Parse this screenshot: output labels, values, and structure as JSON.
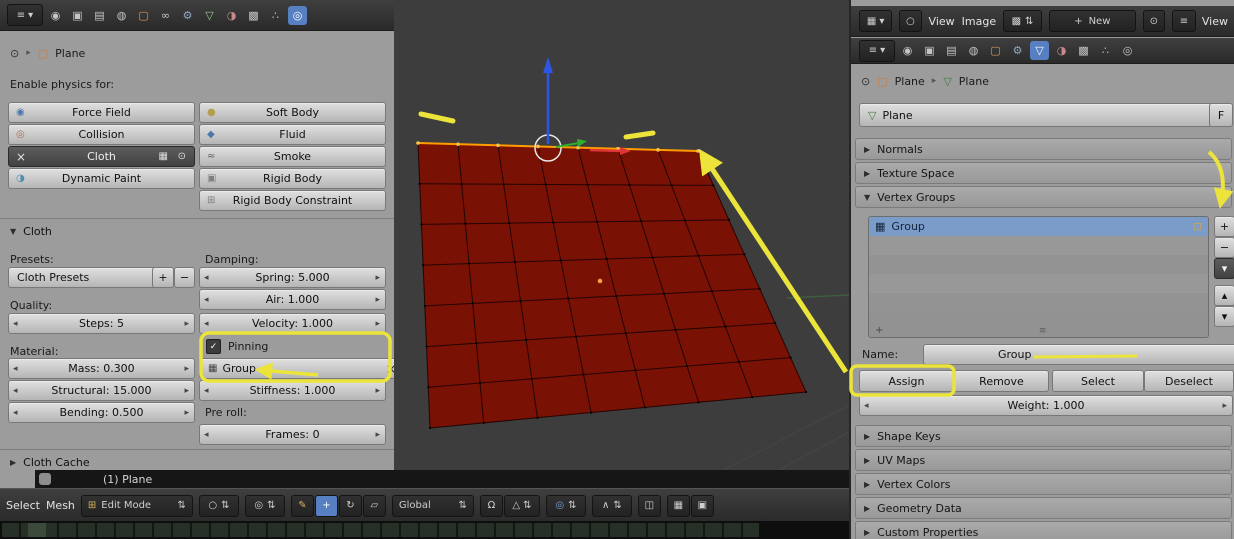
{
  "colors": {
    "accent_blue": "#5680c2",
    "annotation_yellow": "#ece43a",
    "cloth_red": "#7a1105",
    "cloth_wire": "#240402",
    "selected_edge_orange": "#ff9d00",
    "list_selection_blue": "#7b9cc9"
  },
  "icons": {
    "editor_type": "≡",
    "dropdown": "▾",
    "updown": "⇅",
    "pin": "⊙",
    "chevron_right": "▸",
    "cube": "▢",
    "mesh_data": "▽",
    "render_tab": "◉",
    "layers_tab": "▣",
    "scene_tab": "▤",
    "world_tab": "◍",
    "object_tab": "▢",
    "constraints_tab": "∞",
    "modifiers_tab": "⚙",
    "data_tab": "▽",
    "material_tab": "◑",
    "texture_tab": "▩",
    "particles_tab": "∴",
    "physics_tab": "◎",
    "force_field": "◉",
    "collision": "◎",
    "x": "×",
    "dynamic_paint": "◑",
    "soft_body": "●",
    "fluid": "◆",
    "smoke": "≈",
    "rigid_body": "▣",
    "rigid_constraint": "⊞",
    "camera": "▦",
    "eye": "⊙",
    "check": "✓",
    "left": "◂",
    "right": "▸",
    "tri_right": "▶",
    "tri_down": "▼",
    "plus": "+",
    "minus": "−",
    "up": "▴",
    "down": "▾",
    "group": "▦",
    "lock": "⊡",
    "grip": "≡",
    "grid": "⊞",
    "sphere": "○",
    "pivot": "◎",
    "pencil": "✎",
    "translate": "+",
    "rotate": "↻",
    "scale": "▱",
    "magnet": "Ω",
    "snap_element": "△",
    "prop_circle": "◎",
    "falloff": "∧",
    "occlude": "◫",
    "image": "▦",
    "circle": "○"
  },
  "left_panel": {
    "breadcrumb_object": "Plane",
    "enable_label": "Enable physics for:",
    "physics_left": [
      {
        "label": "Force Field"
      },
      {
        "label": "Collision"
      },
      {
        "label": "Cloth"
      },
      {
        "label": "Dynamic Paint"
      }
    ],
    "physics_right": [
      {
        "label": "Soft Body"
      },
      {
        "label": "Fluid"
      },
      {
        "label": "Smoke"
      },
      {
        "label": "Rigid Body"
      },
      {
        "label": "Rigid Body Constraint"
      }
    ],
    "cloth": {
      "title": "Cloth",
      "presets_label": "Presets:",
      "presets_value": "Cloth Presets",
      "quality_label": "Quality:",
      "steps": "Steps: 5",
      "material_label": "Material:",
      "mass": "Mass: 0.300",
      "structural": "Structural: 15.000",
      "bending": "Bending: 0.500",
      "damping_label": "Damping:",
      "spring": "Spring: 5.000",
      "air": "Air: 1.000",
      "velocity": "Velocity: 1.000",
      "pinning": "Pinning",
      "group": "Group",
      "stiffness": "Stiffness: 1.000",
      "preroll_label": "Pre roll:",
      "frames": "Frames: 0"
    },
    "cache_title": "Cloth Cache"
  },
  "viewport": {
    "info": "(1) Plane",
    "select_menu": "Select",
    "mesh_menu": "Mesh",
    "mode": "Edit Mode",
    "orientation": "Global"
  },
  "right_panel": {
    "view_menu": "View",
    "image_menu": "Image",
    "new_button": "New",
    "corner_view_menu": "View",
    "breadcrumb_object": "Plane",
    "breadcrumb_data": "Plane",
    "name_value": "Plane",
    "fake_user": "F",
    "sections": {
      "normals": "Normals",
      "texture_space": "Texture Space",
      "vertex_groups": "Vertex Groups",
      "shape_keys": "Shape Keys",
      "uv_maps": "UV Maps",
      "vertex_colors": "Vertex Colors",
      "geometry_data": "Geometry Data",
      "custom_properties": "Custom Properties"
    },
    "vertex_groups": {
      "group_name": "Group",
      "name_label": "Name:",
      "name_value": "Group",
      "assign": "Assign",
      "remove": "Remove",
      "select": "Select",
      "deselect": "Deselect",
      "weight": "Weight: 1.000"
    }
  }
}
